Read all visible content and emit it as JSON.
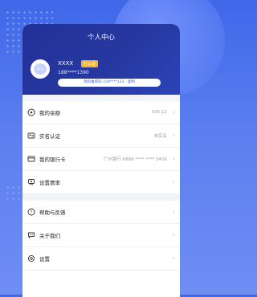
{
  "page": {
    "title": "个人中心"
  },
  "profile": {
    "name": "XXXX",
    "badge": "已认证",
    "phone": "188****1390",
    "invite": "我的推荐码 109****133 · 复制"
  },
  "menu_group1": [
    {
      "label": "我的余额",
      "value": "435.12",
      "icon": "wallet-icon"
    },
    {
      "label": "实名认证",
      "value": "未实名",
      "icon": "id-card-icon"
    },
    {
      "label": "我的银行卡",
      "value": "广州银行 6889 **** **** 3456",
      "icon": "bank-card-icon"
    },
    {
      "label": "设置费率",
      "value": "",
      "icon": "rate-icon"
    }
  ],
  "menu_group2": [
    {
      "label": "帮助与反馈",
      "icon": "help-icon"
    },
    {
      "label": "关于我们",
      "icon": "chat-bubble-icon"
    },
    {
      "label": "设置",
      "icon": "settings-icon"
    }
  ],
  "colors": {
    "header": "#26389f",
    "accent": "#4a64e0",
    "badge": "#f2b530"
  }
}
